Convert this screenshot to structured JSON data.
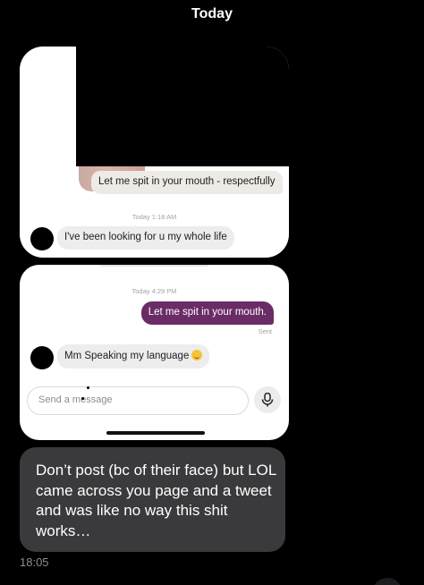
{
  "header": {
    "day": "Today"
  },
  "screenshot1": {
    "outgoing_message": "Let me spit in your mouth - respectfully",
    "timestamp": "Today 1:18 AM",
    "incoming_message": "I've been looking for u my whole life"
  },
  "screenshot2": {
    "timestamp": "Today 4:29 PM",
    "outgoing_message": "Let me spit in your mouth.",
    "status": "Sent",
    "incoming_message": "Mm Speaking my language",
    "incoming_emoji": "smiling-face-emoji",
    "compose_placeholder": "Send a message",
    "accent_color": "#6a2c66"
  },
  "message": {
    "text": "Don’t post (bc of their face) but LOL came across you page and a tweet and was like no way this shit works…",
    "time": "18:05"
  }
}
